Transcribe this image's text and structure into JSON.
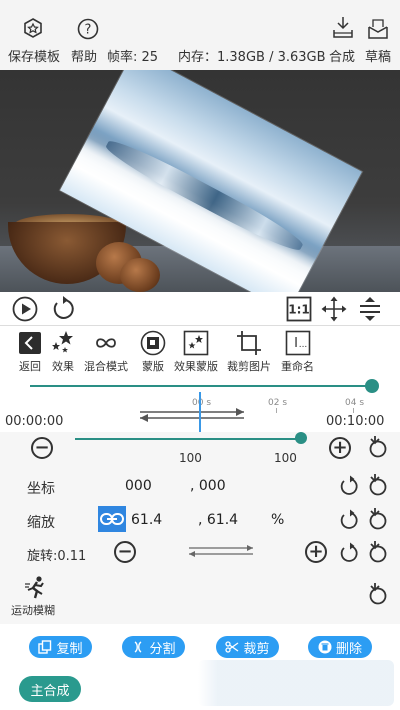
{
  "topbar": {
    "save_template": "保存模板",
    "help": "帮助",
    "frame_rate": "帧率: 25",
    "memory": "内存：1.38GB / 3.63GB",
    "compose": "合成",
    "draft": "草稿"
  },
  "effects_toolbar": [
    {
      "label": "返回",
      "icon": "back-icon"
    },
    {
      "label": "效果",
      "icon": "sparkle-icon"
    },
    {
      "label": "混合模式",
      "icon": "infinity-icon"
    },
    {
      "label": "蒙版",
      "icon": "mask-icon"
    },
    {
      "label": "效果蒙版",
      "icon": "effect-mask-icon"
    },
    {
      "label": "裁剪图片",
      "icon": "crop-icon"
    },
    {
      "label": "重命名",
      "icon": "rename-icon"
    }
  ],
  "timeline": {
    "start_time": "00:00:00",
    "end_time": "00:10:00",
    "ticks": [
      "00 s",
      "02 s",
      "04 s"
    ],
    "progress_fraction": 1.0
  },
  "opacity": {
    "left_value": "100",
    "right_value": "100",
    "level_fraction": 0.98
  },
  "properties": {
    "position_label": "坐标",
    "position_x": "000",
    "position_y": ", 000",
    "scale_label": "缩放",
    "scale_x": "61.4",
    "scale_y": ", 61.4",
    "scale_unit": "%",
    "rotation_label": "旋转:0.11",
    "motion_blur_label": "运动模糊"
  },
  "actions": {
    "copy": "复制",
    "split": "分割",
    "cut": "裁剪",
    "delete": "删除",
    "compose": "主合成"
  },
  "colors": {
    "accent_teal": "#2a8f85",
    "button_blue": "#2c9df3"
  }
}
